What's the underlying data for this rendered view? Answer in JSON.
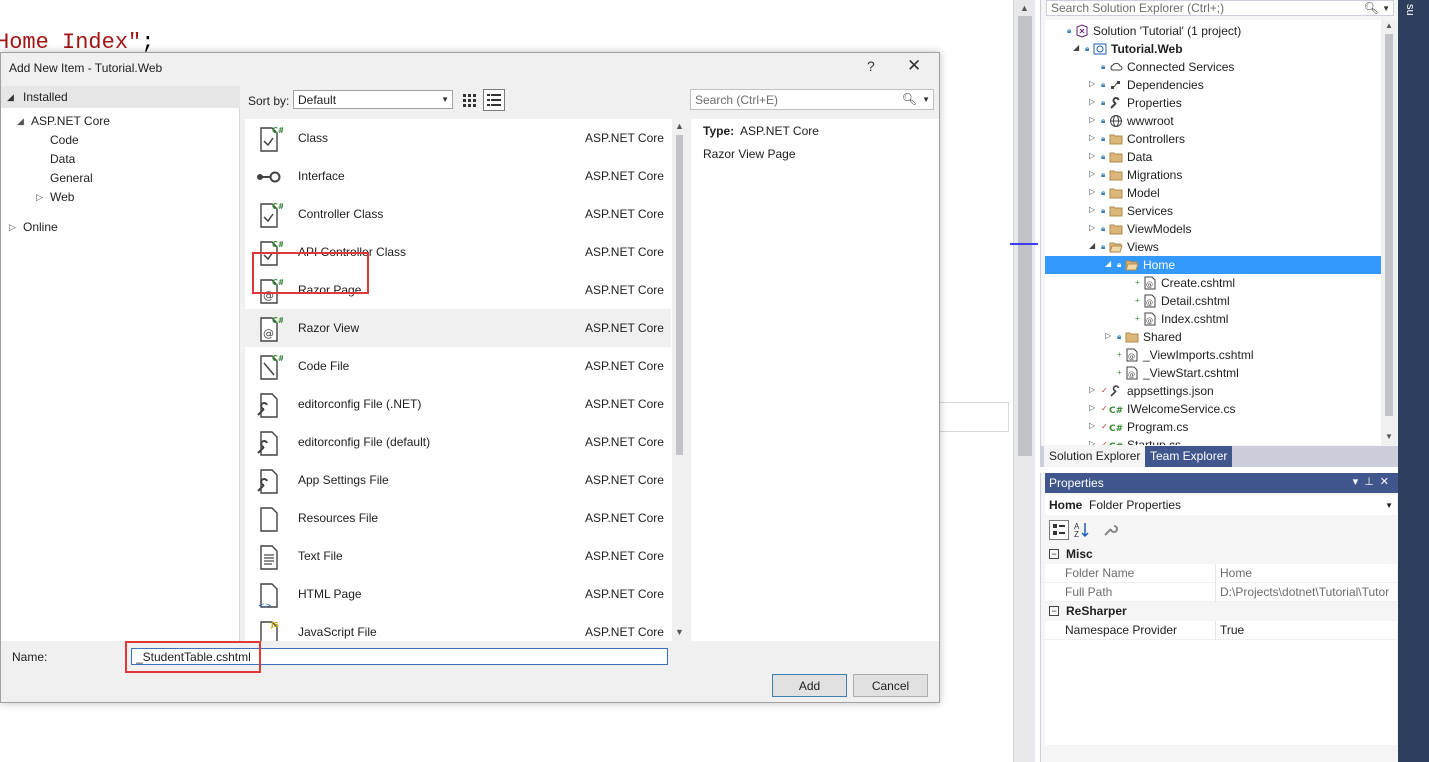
{
  "editor": {
    "code_line": "Home Index\"",
    "code_end": ";"
  },
  "dialog": {
    "title": "Add New Item - Tutorial.Web",
    "help": "?",
    "close": "✕",
    "categories": {
      "installed": "Installed",
      "aspnet": "ASP.NET Core",
      "children": [
        "Code",
        "Data",
        "General",
        "Web"
      ],
      "online": "Online"
    },
    "toolbar": {
      "sort_label": "Sort by:",
      "sort_value": "Default",
      "search_placeholder": "Search (Ctrl+E)"
    },
    "templates": [
      {
        "name": "Class",
        "category": "ASP.NET Core",
        "icon": "csharp-class-icon"
      },
      {
        "name": "Interface",
        "category": "ASP.NET Core",
        "icon": "interface-icon"
      },
      {
        "name": "Controller Class",
        "category": "ASP.NET Core",
        "icon": "controller-class-icon"
      },
      {
        "name": "API Controller Class",
        "category": "ASP.NET Core",
        "icon": "api-controller-icon"
      },
      {
        "name": "Razor Page",
        "category": "ASP.NET Core",
        "icon": "razor-page-icon"
      },
      {
        "name": "Razor View",
        "category": "ASP.NET Core",
        "icon": "razor-view-icon"
      },
      {
        "name": "Code File",
        "category": "ASP.NET Core",
        "icon": "code-file-icon"
      },
      {
        "name": "editorconfig File (.NET)",
        "category": "ASP.NET Core",
        "icon": "editorconfig-icon"
      },
      {
        "name": "editorconfig File (default)",
        "category": "ASP.NET Core",
        "icon": "editorconfig-icon"
      },
      {
        "name": "App Settings File",
        "category": "ASP.NET Core",
        "icon": "app-settings-icon"
      },
      {
        "name": "Resources File",
        "category": "ASP.NET Core",
        "icon": "resources-file-icon"
      },
      {
        "name": "Text File",
        "category": "ASP.NET Core",
        "icon": "text-file-icon"
      },
      {
        "name": "HTML Page",
        "category": "ASP.NET Core",
        "icon": "html-page-icon"
      },
      {
        "name": "JavaScript File",
        "category": "ASP.NET Core",
        "icon": "javascript-file-icon"
      }
    ],
    "selected_template": "Razor View",
    "description": {
      "type_label": "Type:",
      "type_value": "ASP.NET Core",
      "text": "Razor View Page"
    },
    "name_label": "Name:",
    "name_value": "_StudentTable.cshtml",
    "add_label": "Add",
    "cancel_label": "Cancel"
  },
  "solution_explorer": {
    "search_placeholder": "Search Solution Explorer (Ctrl+;)",
    "items": [
      {
        "label": "Solution 'Tutorial' (1 project)",
        "depth": 0,
        "expander": "",
        "icon": "solution-icon"
      },
      {
        "label": "Tutorial.Web",
        "depth": 1,
        "expander": "open",
        "icon": "web-project-icon",
        "bold": true
      },
      {
        "label": "Connected Services",
        "depth": 2,
        "expander": "",
        "icon": "connected-services-icon"
      },
      {
        "label": "Dependencies",
        "depth": 2,
        "expander": "closed",
        "icon": "dependencies-icon"
      },
      {
        "label": "Properties",
        "depth": 2,
        "expander": "closed",
        "icon": "wrench-icon"
      },
      {
        "label": "wwwroot",
        "depth": 2,
        "expander": "closed",
        "icon": "globe-icon"
      },
      {
        "label": "Controllers",
        "depth": 2,
        "expander": "closed",
        "icon": "folder-icon"
      },
      {
        "label": "Data",
        "depth": 2,
        "expander": "closed",
        "icon": "folder-icon"
      },
      {
        "label": "Migrations",
        "depth": 2,
        "expander": "closed",
        "icon": "folder-icon"
      },
      {
        "label": "Model",
        "depth": 2,
        "expander": "closed",
        "icon": "folder-icon"
      },
      {
        "label": "Services",
        "depth": 2,
        "expander": "closed",
        "icon": "folder-icon"
      },
      {
        "label": "ViewModels",
        "depth": 2,
        "expander": "closed",
        "icon": "folder-icon"
      },
      {
        "label": "Views",
        "depth": 2,
        "expander": "open",
        "icon": "folder-open-icon"
      },
      {
        "label": "Home",
        "depth": 3,
        "expander": "open",
        "icon": "folder-open-icon",
        "selected": true
      },
      {
        "label": "Create.cshtml",
        "depth": 4,
        "expander": "",
        "icon": "cshtml-file-icon"
      },
      {
        "label": "Detail.cshtml",
        "depth": 4,
        "expander": "",
        "icon": "cshtml-file-icon"
      },
      {
        "label": "Index.cshtml",
        "depth": 4,
        "expander": "",
        "icon": "cshtml-file-icon"
      },
      {
        "label": "Shared",
        "depth": 3,
        "expander": "closed",
        "icon": "folder-icon"
      },
      {
        "label": "_ViewImports.cshtml",
        "depth": 3,
        "expander": "",
        "icon": "cshtml-file-icon"
      },
      {
        "label": "_ViewStart.cshtml",
        "depth": 3,
        "expander": "",
        "icon": "cshtml-file-icon"
      },
      {
        "label": "appsettings.json",
        "depth": 2,
        "expander": "closed",
        "icon": "json-file-icon"
      },
      {
        "label": "IWelcomeService.cs",
        "depth": 2,
        "expander": "closed",
        "icon": "csharp-file-icon"
      },
      {
        "label": "Program.cs",
        "depth": 2,
        "expander": "closed",
        "icon": "csharp-file-icon"
      },
      {
        "label": "Startup.cs",
        "depth": 2,
        "expander": "closed",
        "icon": "csharp-file-icon"
      }
    ],
    "tabs": [
      "Solution Explorer",
      "Team Explorer"
    ]
  },
  "properties": {
    "title": "Properties",
    "object_name": "Home",
    "object_type": "Folder Properties",
    "categories": [
      {
        "name": "Misc",
        "rows": [
          {
            "key": "Folder Name",
            "value": "Home"
          },
          {
            "key": "Full Path",
            "value": "D:\\Projects\\dotnet\\Tutorial\\Tutor"
          }
        ]
      },
      {
        "name": "ReSharper",
        "rows": [
          {
            "key": "Namespace Provider",
            "value": "True"
          }
        ]
      }
    ]
  },
  "right_strip_text": "su",
  "colors": {
    "accent": "#3399ff",
    "panel_header": "#40568d",
    "highlight": "#e03838",
    "csharp_green": "#68217a"
  }
}
